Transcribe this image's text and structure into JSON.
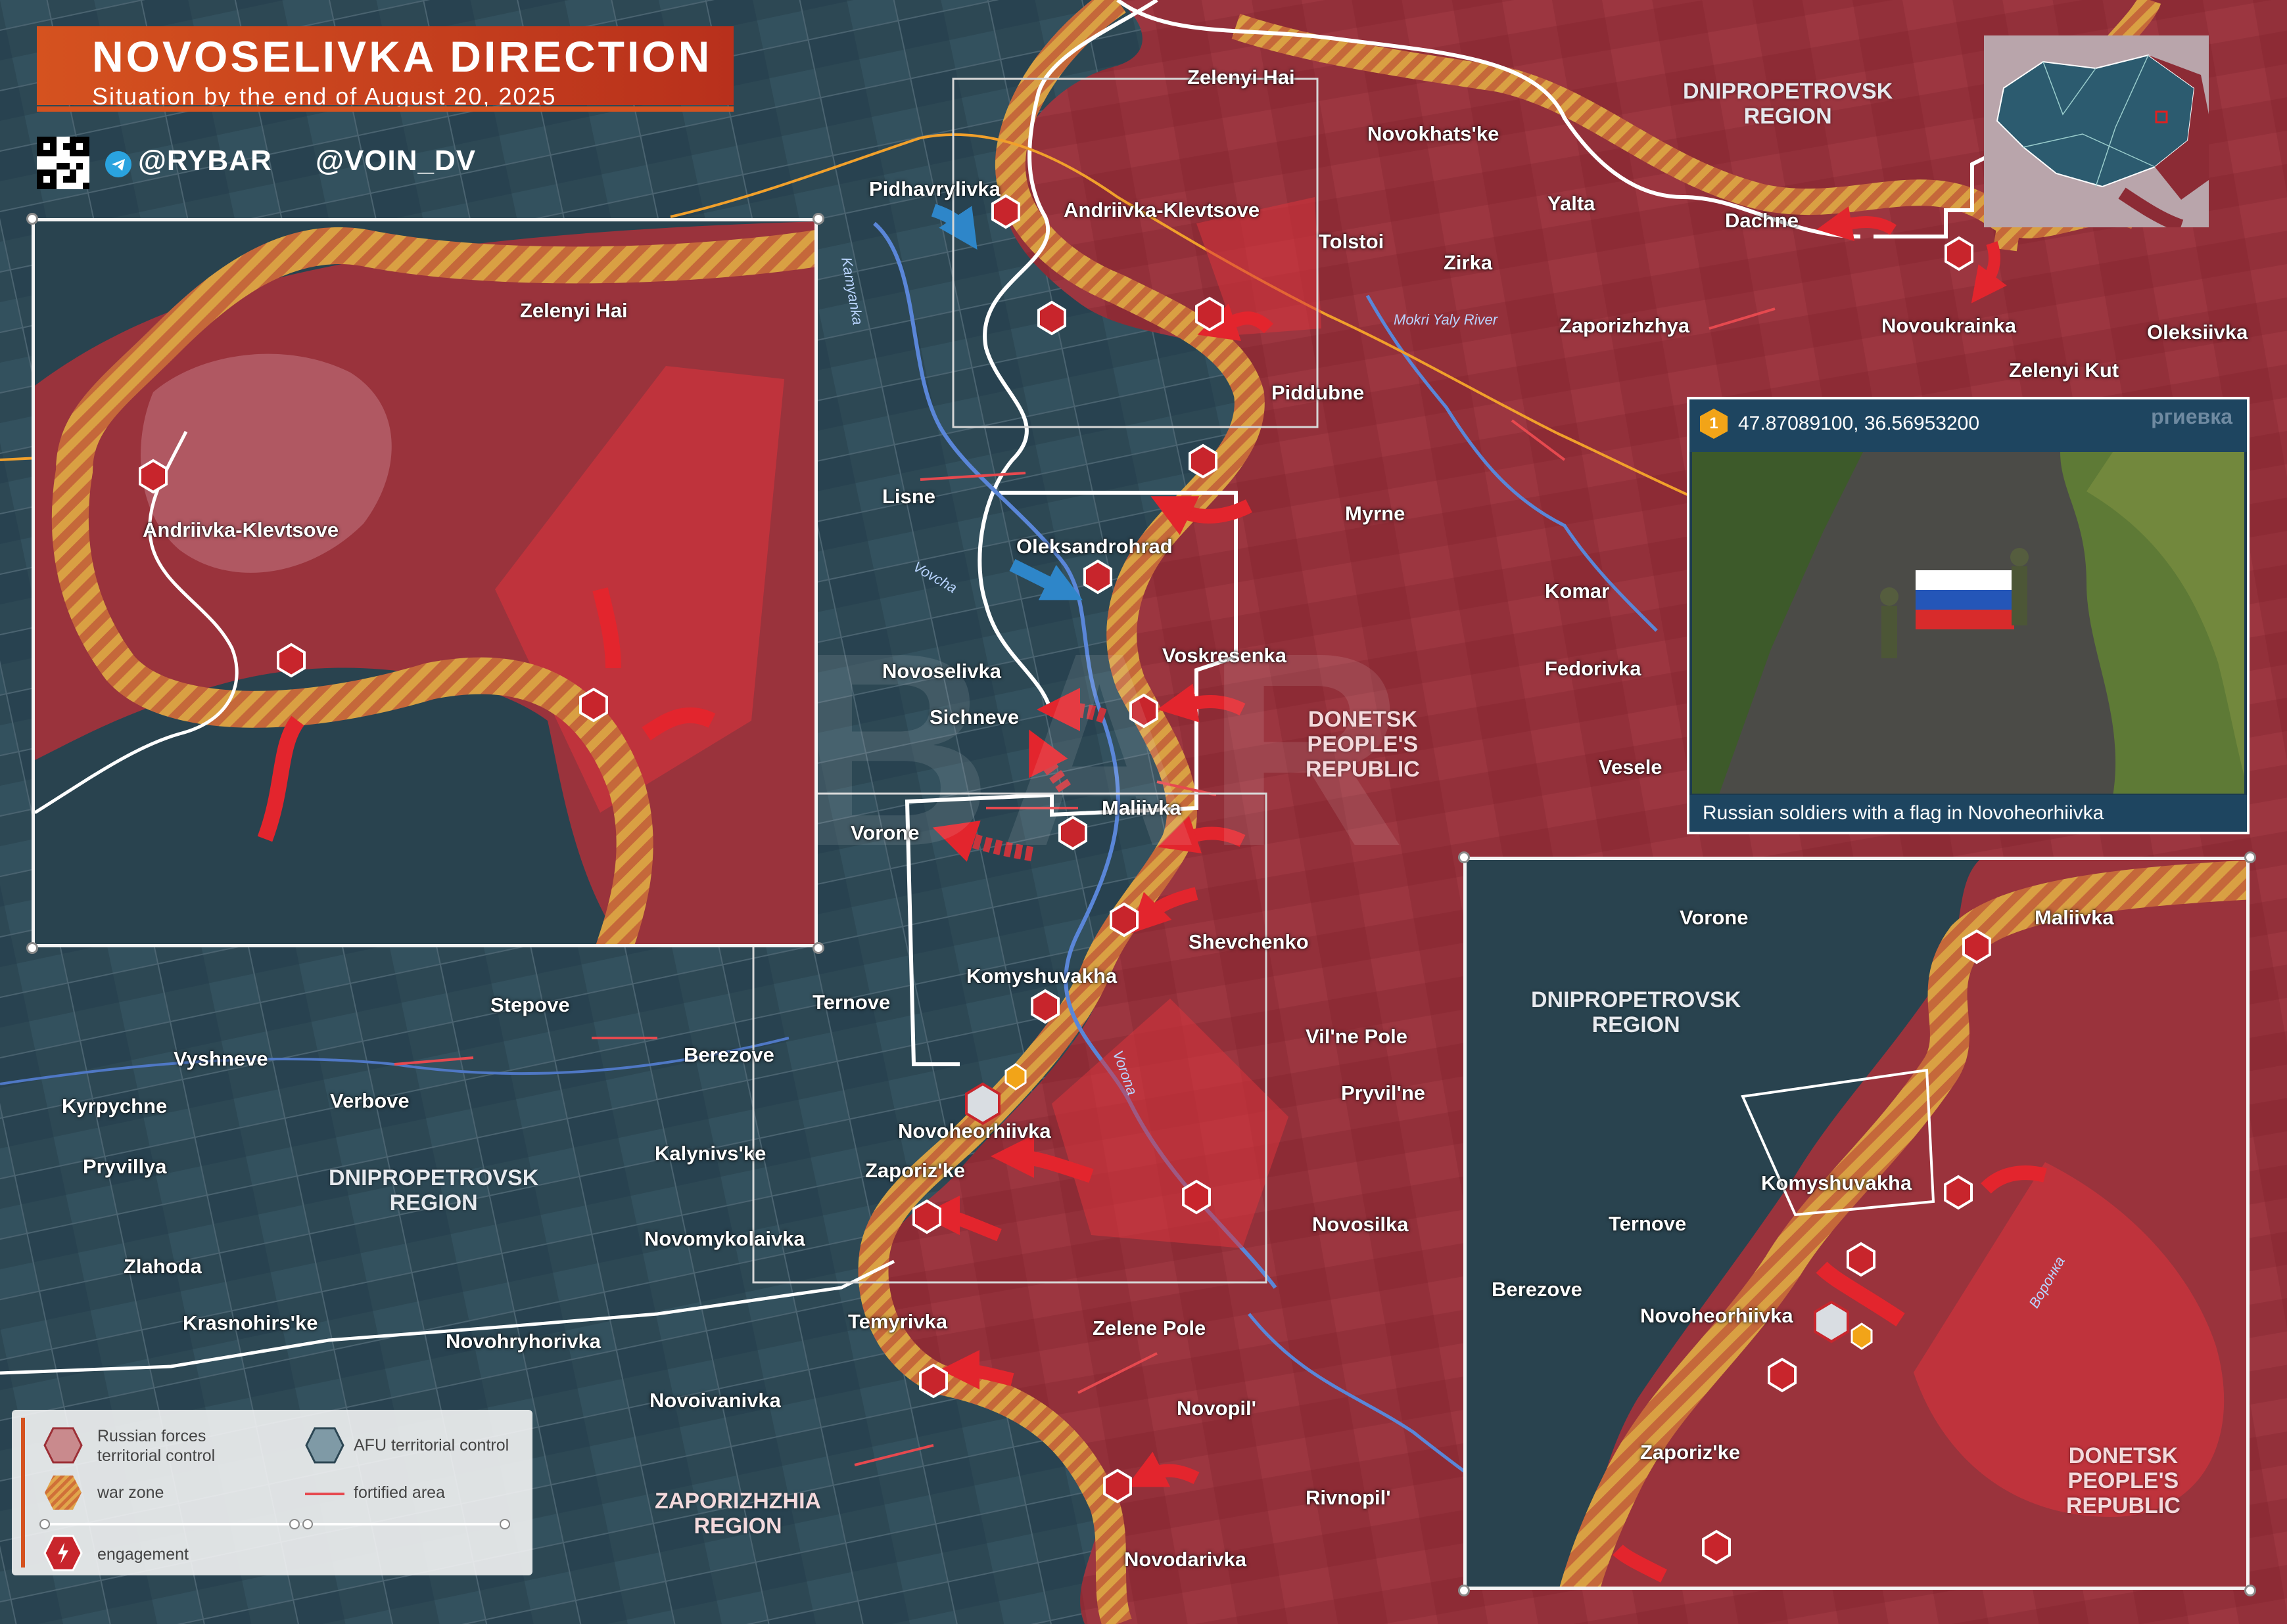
{
  "title": "NOVOSELIVKA DIRECTION",
  "subtitle": "Situation by the end of August 20, 2025",
  "social": {
    "telegram": "@RYBAR",
    "handle2": "@VOIN_DV"
  },
  "colors": {
    "russian": "#9c2f36",
    "afu": "#2c4653",
    "war_zone": "#d69a3f",
    "engagement": "#c8252c",
    "frontline": "#ffffff",
    "accent": "#d5521f"
  },
  "regions": {
    "dnipro_top": [
      "DNIPROPETROVSK",
      "REGION"
    ],
    "dnipro_mid": [
      "DNIPROPETROVSK",
      "REGION"
    ],
    "donetsk_mid": [
      "DONETSK",
      "PEOPLE'S",
      "REPUBLIC"
    ],
    "zaporizhzhia": [
      "ZAPORIZHZHIA",
      "REGION"
    ],
    "inset_dnipro": [
      "DNIPROPETROVSK",
      "REGION"
    ],
    "inset_donetsk": [
      "DONETSK",
      "PEOPLE'S",
      "REPUBLIC"
    ]
  },
  "rivers": [
    "Kamyanka",
    "Vovcha",
    "Mokri Yaly River",
    "Vorona",
    "Воронка"
  ],
  "settlements": {
    "zelenyi_hai": "Zelenyi Hai",
    "novokhatske": "Novokhats'ke",
    "dniprop_label": "DNIPROPETROVSK",
    "pidhavrylivka": "Pidhavrylivka",
    "andriivka": "Andriivka-Klevtsove",
    "tolstoi": "Tolstoi",
    "yalta": "Yalta",
    "dachne": "Dachne",
    "zirka": "Zirka",
    "zaporizhzhya": "Zaporizhzhya",
    "novoukrainka": "Novoukrainka",
    "oleksiivka": "Oleksiivka",
    "zelenyi_kut": "Zelenyi Kut",
    "piddubne": "Piddubne",
    "lisne": "Lisne",
    "myrne": "Myrne",
    "oleksandrohrad": "Oleksandrohrad",
    "komar": "Komar",
    "voskresenka": "Voskresenka",
    "fedorivka": "Fedorivka",
    "novoselivka": "Novoselivka",
    "sichneve": "Sichneve",
    "vesele": "Vesele",
    "maliivka": "Maliivka",
    "vorone": "Vorone",
    "shevchenko": "Shevchenko",
    "stepove": "Stepove",
    "ternove": "Ternove",
    "komyshuvakha": "Komyshuvakha",
    "vilne_pole": "Vil'ne Pole",
    "vyshneve": "Vyshneve",
    "berezove": "Berezove",
    "pryvilne": "Pryvil'ne",
    "kyrpychne": "Kyrpychne",
    "verbove": "Verbove",
    "novoheorhiivka": "Novoheorhiivka",
    "pryvillya": "Pryvillya",
    "kalynivske": "Kalynivs'ke",
    "zaporizke": "Zaporiz'ke",
    "novomykolaivka": "Novomykolaivka",
    "novosilka": "Novosilka",
    "zlahoda": "Zlahoda",
    "krasnohirske": "Krasnohirs'ke",
    "temyrivka": "Temyrivka",
    "zelene_pole": "Zelene Pole",
    "novohryhorivka": "Novohryhorivka",
    "novoivanivka": "Novoivanivka",
    "novopil": "Novopil'",
    "rivnopil": "Rivnopil'",
    "novodarivka": "Novodarivka"
  },
  "inset_left": {
    "zelenyi_hai": "Zelenyi Hai",
    "andriivka": "Andriivka-Klevtsove"
  },
  "inset_right": {
    "vorone": "Vorone",
    "maliivka": "Maliivka",
    "ternove": "Ternove",
    "komyshuvakha": "Komyshuvakha",
    "berezove": "Berezove",
    "novoheorhiivka": "Novoheorhiivka",
    "zaporizke": "Zaporiz'ke"
  },
  "photo": {
    "marker": "1",
    "coords": "47.87089100, 36.56953200",
    "caption": "Russian soldiers with a flag in Novoheorhiivka",
    "overlay_text": "ргиевка"
  },
  "legend": {
    "russian": [
      "Russian forces",
      "territorial control"
    ],
    "afu": "AFU territorial control",
    "war_zone": "war zone",
    "fortified": "fortified area",
    "engagement": "engagement"
  },
  "watermark": "@RYBAR"
}
